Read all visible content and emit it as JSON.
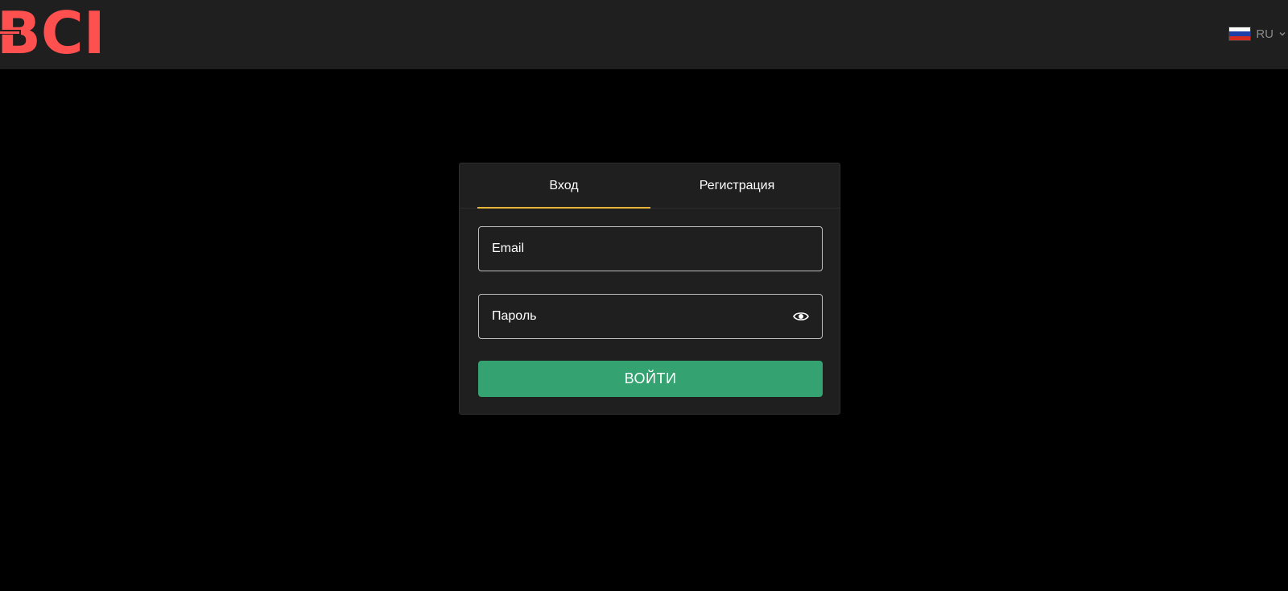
{
  "header": {
    "logo_text": "BCI",
    "language_code": "RU",
    "language_flag": "russia-flag-icon",
    "flag_colors": [
      "#ffffff",
      "#1e3fa8",
      "#d52b1e"
    ]
  },
  "auth_card": {
    "tabs": [
      {
        "label": "Вход",
        "active": true
      },
      {
        "label": "Регистрация",
        "active": false
      }
    ],
    "email": {
      "placeholder": "Email",
      "value": ""
    },
    "password": {
      "placeholder": "Пароль",
      "value": "",
      "toggle_icon": "eye-icon"
    },
    "submit_label": "ВОЙТИ"
  },
  "colors": {
    "logo": "#ff5050",
    "header_bg": "#1f1f1f",
    "page_bg": "#000000",
    "card_bg": "#1f1f1f",
    "active_tab_underline": "#e8b43a",
    "submit_bg": "#34a271"
  }
}
